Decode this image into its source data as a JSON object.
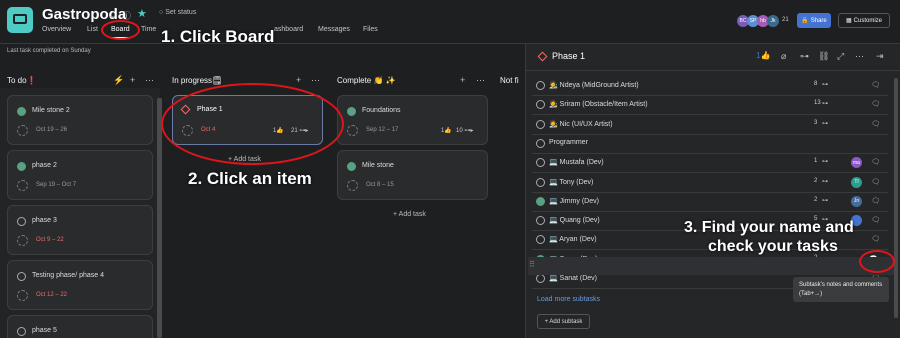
{
  "header": {
    "project_title": "Gastropoda",
    "set_status": "Set status",
    "tabs": [
      "Overview",
      "List",
      "Board",
      "Time",
      "ashboard",
      "Messages",
      "Files"
    ],
    "avatars": [
      "BC",
      "SP",
      "hb",
      "Jk"
    ],
    "member_count": "21",
    "share_label": "Share",
    "customize_label": "Customize"
  },
  "last_completed": "Last task completed on Sunday",
  "columns": [
    {
      "title": "To do",
      "emoji": "❗"
    },
    {
      "title": "In progress",
      "emoji": "🗒"
    },
    {
      "title": "Complete",
      "emoji": "👏 ✨"
    },
    {
      "title": "Not fi"
    }
  ],
  "todo_cards": [
    {
      "title": "Mile stone 2",
      "date": "Oct 19 – 26",
      "done": true
    },
    {
      "title": "phase 2",
      "date": "Sep 19 – Oct 7",
      "done": true
    },
    {
      "title": "phase 3",
      "date": "Oct 9 – 22",
      "done": false
    },
    {
      "title": "Testing phase/ phase 4",
      "date": "Oct 12 – 22",
      "done": false
    },
    {
      "title": "phase 5",
      "date": "",
      "done": false
    }
  ],
  "progress_card": {
    "title": "Phase 1",
    "date": "Oct 4",
    "likes": "1",
    "subtasks": "21"
  },
  "complete_cards": [
    {
      "title": "Foundations",
      "date": "Sep 12 – 17",
      "likes": "1",
      "subtasks": "10"
    },
    {
      "title": "Mile stone",
      "date": "Oct 8 – 15"
    }
  ],
  "add_task": "+ Add task",
  "panel": {
    "title": "Phase 1",
    "likes": "1",
    "rows": [
      {
        "name": "🧑‍🎨 Ndeya (MidGround Artist)",
        "count": "8"
      },
      {
        "name": "🧑‍🎨 Sriram (Obstacle/Item Artist)",
        "count": "13"
      },
      {
        "name": "🧑‍🎨 Nic (UI/UX Artist)",
        "count": "3"
      },
      {
        "name": "Programmer",
        "count": ""
      },
      {
        "name": "💻 Mustafa (Dev)",
        "count": "1",
        "avatar": "ma",
        "avatar_color": "#8d58c9"
      },
      {
        "name": "💻 Tony (Dev)",
        "count": "2",
        "avatar": "Tl",
        "avatar_color": "#2a9d8f"
      },
      {
        "name": "💻 Jimmy (Dev)",
        "count": "2",
        "avatar": "Jn",
        "avatar_color": "#476b9a"
      },
      {
        "name": "💻 Quang (Dev)",
        "count": "5",
        "avatar": "",
        "avatar_color": "#4573d2"
      },
      {
        "name": "💻 Aryan (Dev)",
        "count": "",
        "avatar": "",
        "avatar_color": ""
      },
      {
        "name": "💻 Sagar (Dev)",
        "count": "2",
        "avatar": "",
        "avatar_color": ""
      },
      {
        "name": "💻 Sanat (Dev)",
        "count": "",
        "avatar": "",
        "avatar_color": ""
      }
    ],
    "load_more": "Load more subtasks",
    "add_subtask": "+ Add subtask",
    "tooltip": "Subtask's notes and comments (Tab+→)"
  },
  "annotations": {
    "step1": "1. Click Board",
    "step2": "2. Click an item",
    "step3_line1": "3. Find your name and",
    "step3_line2": "check your tasks"
  },
  "colors": {
    "accent": "#4573d2",
    "ring": "#e0151b",
    "teal": "#4ecbc4"
  }
}
